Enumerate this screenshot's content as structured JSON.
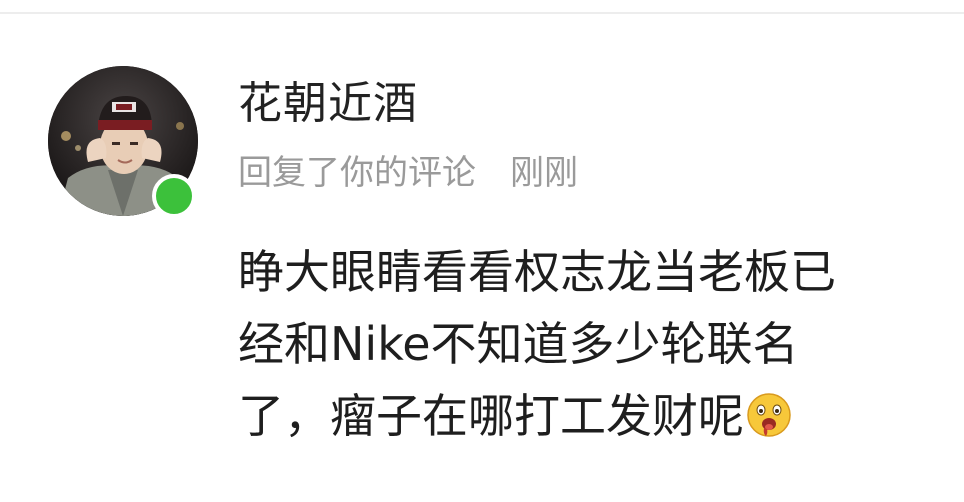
{
  "comment_card": {
    "user_name": "花朝近酒",
    "action_text": "回复了你的评论",
    "time_text": "刚刚",
    "avatar_icon": "user-avatar-photo",
    "status_icon": "online-status-dot",
    "status_color": "#3cc13b",
    "comment_lines": [
      "睁大眼睛看看权志龙当老板已",
      "经和Nike不知道多少轮联名",
      "了，瘤子在哪打工发财呢"
    ],
    "comment_emoji": "drooling-face-emoji"
  }
}
